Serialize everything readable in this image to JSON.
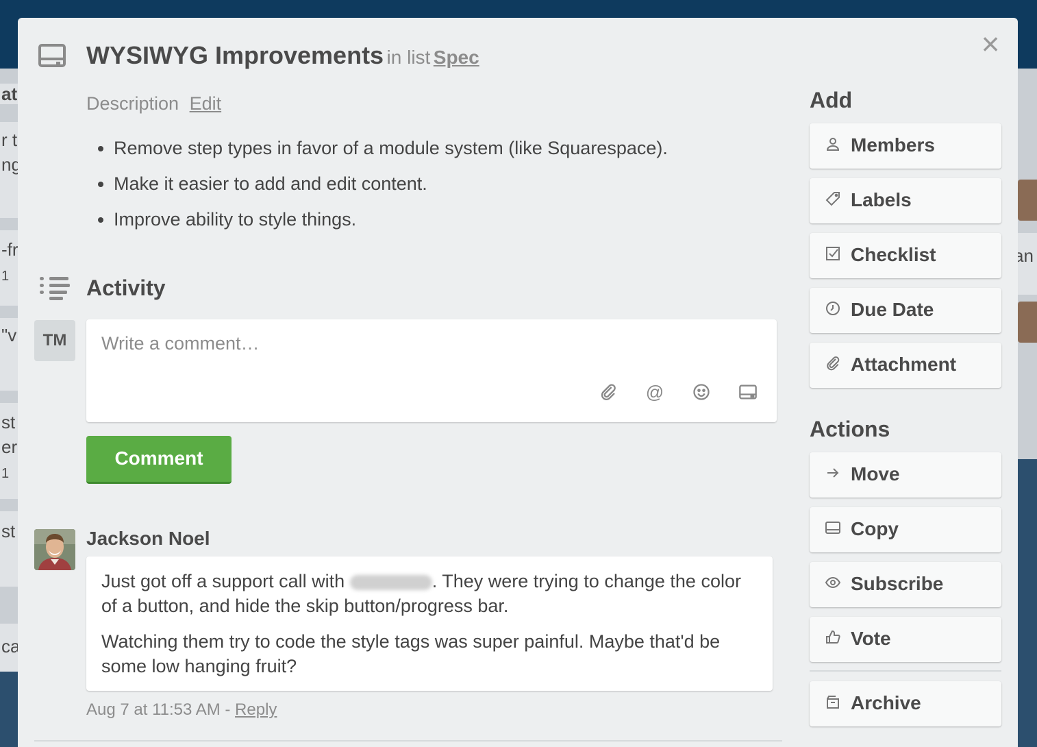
{
  "card": {
    "title": "WYSIWYG Improvements",
    "in_list_prefix": "in list",
    "list_name": "Spec"
  },
  "description": {
    "label": "Description",
    "edit_label": "Edit",
    "items": [
      "Remove step types in favor of a module system (like Squarespace).",
      "Make it easier to add and edit content.",
      "Improve ability to style things."
    ]
  },
  "activity": {
    "title": "Activity",
    "current_user_initials": "TM",
    "comment_placeholder": "Write a comment…",
    "comment_button": "Comment",
    "toolbar_icons": [
      "paperclip-icon",
      "at-icon",
      "emoji-icon",
      "card-icon"
    ]
  },
  "comments": [
    {
      "author": "Jackson Noel",
      "text_part1": "Just got off a support call with",
      "text_part2": ". They were trying to change the color of a button, and hide the skip button/progress bar.",
      "text_para2": "Watching them try to code the style tags was super painful. Maybe that'd be some low hanging fruit?",
      "timestamp": "Aug 7 at 11:53 AM",
      "separator": "-",
      "reply_label": "Reply"
    }
  ],
  "sidebar": {
    "add_title": "Add",
    "add_items": [
      {
        "label": "Members",
        "icon": "person-icon"
      },
      {
        "label": "Labels",
        "icon": "tag-icon"
      },
      {
        "label": "Checklist",
        "icon": "checkbox-icon"
      },
      {
        "label": "Due Date",
        "icon": "clock-icon"
      },
      {
        "label": "Attachment",
        "icon": "paperclip-icon"
      }
    ],
    "actions_title": "Actions",
    "action_items": [
      {
        "label": "Move",
        "icon": "arrow-right-icon"
      },
      {
        "label": "Copy",
        "icon": "card-icon"
      },
      {
        "label": "Subscribe",
        "icon": "eye-icon"
      },
      {
        "label": "Vote",
        "icon": "thumbs-up-icon"
      }
    ],
    "archive_item": {
      "label": "Archive",
      "icon": "archive-icon"
    }
  },
  "background": {
    "left_fragments": [
      "ati",
      "r ta",
      "ng",
      "-fr",
      "1",
      "\"v",
      "st",
      "er",
      "1",
      "st",
      "ca"
    ],
    "right_fragments": [
      "an"
    ]
  },
  "colors": {
    "accent_green": "#5aac44",
    "modal_bg": "#edeff0",
    "board_bg": "#0e3a5e"
  }
}
